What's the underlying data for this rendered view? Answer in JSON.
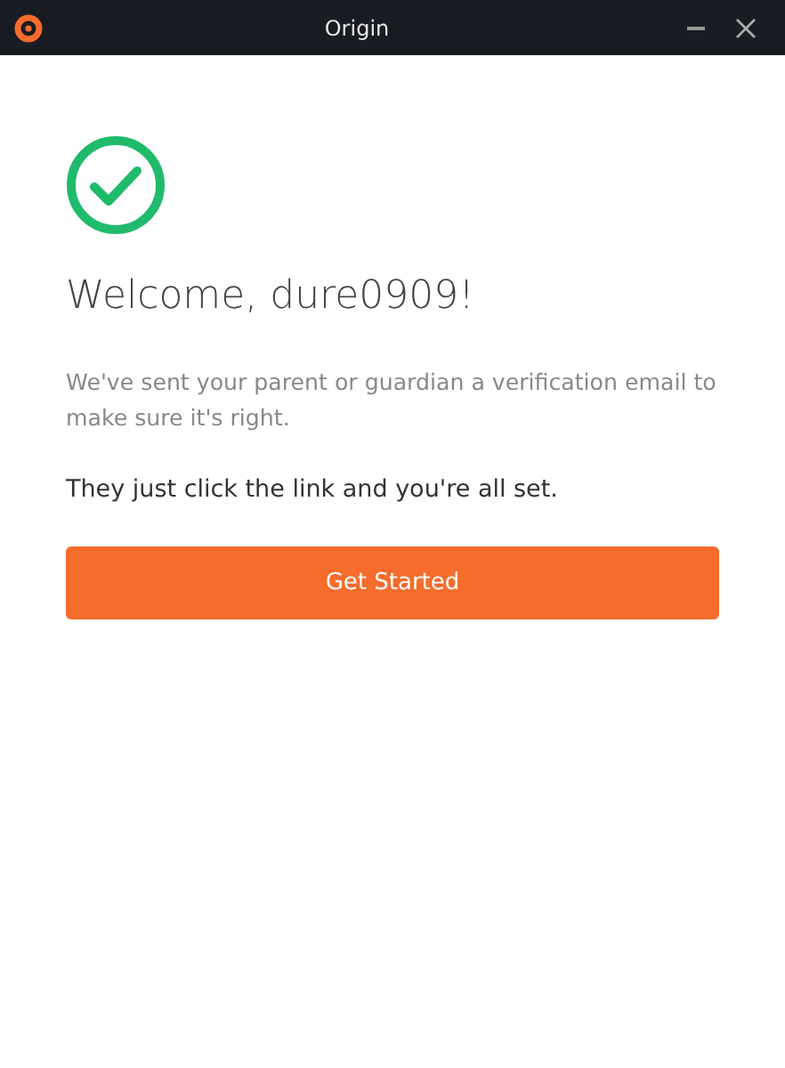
{
  "window": {
    "title": "Origin"
  },
  "heading": "Welcome, dure0909!",
  "message": "We've sent your parent or guardian a verification email to make sure it's right.",
  "note": "They just click the link and you're all set.",
  "button": "Get Started"
}
